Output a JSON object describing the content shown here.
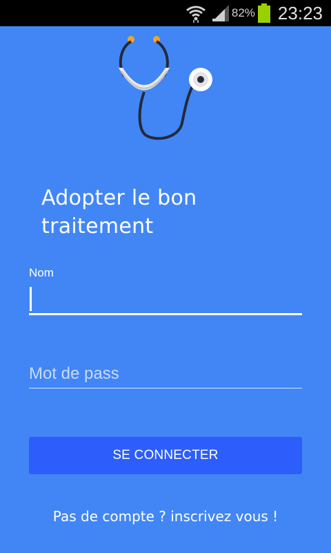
{
  "status_bar": {
    "battery_percent": "82%",
    "time": "23:23",
    "icons": [
      "wifi-icon",
      "signal-icon",
      "battery-icon"
    ],
    "battery_color": "#9bd000"
  },
  "logo": {
    "icon": "stethoscope-icon"
  },
  "title": "Adopter le bon traitement",
  "form": {
    "name_label": "Nom",
    "name_value": "",
    "password_placeholder": "Mot de pass",
    "password_value": "",
    "submit_label": "SE CONNECTER"
  },
  "signup_link": "Pas de compte ? inscrivez vous !",
  "colors": {
    "background": "#4286f5",
    "button": "#2d5dfb",
    "status_bar": "#000000"
  }
}
